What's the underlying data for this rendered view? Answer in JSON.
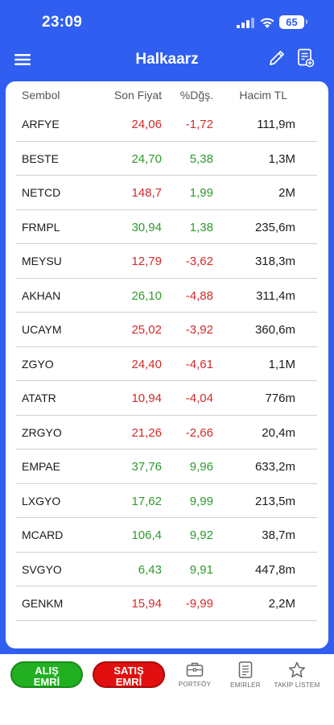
{
  "status": {
    "time": "23:09",
    "battery": "65"
  },
  "header": {
    "title": "Halkaarz"
  },
  "table": {
    "columns": [
      "Sembol",
      "Son Fiyat",
      "%Dğş.",
      "Hacim TL"
    ],
    "rows": [
      {
        "symbol": "ARFYE",
        "price": "24,06",
        "change": "-1,72",
        "volume": "111,9m",
        "price_dir": "down",
        "change_dir": "down"
      },
      {
        "symbol": "BESTE",
        "price": "24,70",
        "change": "5,38",
        "volume": "1,3M",
        "price_dir": "up",
        "change_dir": "up"
      },
      {
        "symbol": "NETCD",
        "price": "148,7",
        "change": "1,99",
        "volume": "2M",
        "price_dir": "down",
        "change_dir": "up"
      },
      {
        "symbol": "FRMPL",
        "price": "30,94",
        "change": "1,38",
        "volume": "235,6m",
        "price_dir": "up",
        "change_dir": "up"
      },
      {
        "symbol": "MEYSU",
        "price": "12,79",
        "change": "-3,62",
        "volume": "318,3m",
        "price_dir": "down",
        "change_dir": "down"
      },
      {
        "symbol": "AKHAN",
        "price": "26,10",
        "change": "-4,88",
        "volume": "311,4m",
        "price_dir": "up",
        "change_dir": "down"
      },
      {
        "symbol": "UCAYM",
        "price": "25,02",
        "change": "-3,92",
        "volume": "360,6m",
        "price_dir": "down",
        "change_dir": "down"
      },
      {
        "symbol": "ZGYO",
        "price": "24,40",
        "change": "-4,61",
        "volume": "1,1M",
        "price_dir": "down",
        "change_dir": "down"
      },
      {
        "symbol": "ATATR",
        "price": "10,94",
        "change": "-4,04",
        "volume": "776m",
        "price_dir": "down",
        "change_dir": "down"
      },
      {
        "symbol": "ZRGYO",
        "price": "21,26",
        "change": "-2,66",
        "volume": "20,4m",
        "price_dir": "down",
        "change_dir": "down"
      },
      {
        "symbol": "EMPAE",
        "price": "37,76",
        "change": "9,96",
        "volume": "633,2m",
        "price_dir": "up",
        "change_dir": "up"
      },
      {
        "symbol": "LXGYO",
        "price": "17,62",
        "change": "9,99",
        "volume": "213,5m",
        "price_dir": "up",
        "change_dir": "up"
      },
      {
        "symbol": "MCARD",
        "price": "106,4",
        "change": "9,92",
        "volume": "38,7m",
        "price_dir": "up",
        "change_dir": "up"
      },
      {
        "symbol": "SVGYO",
        "price": "6,43",
        "change": "9,91",
        "volume": "447,8m",
        "price_dir": "up",
        "change_dir": "up"
      },
      {
        "symbol": "GENKM",
        "price": "15,94",
        "change": "-9,99",
        "volume": "2,2M",
        "price_dir": "down",
        "change_dir": "down"
      }
    ]
  },
  "bottom": {
    "buy_line1": "ALIŞ",
    "buy_line2": "EMRİ",
    "sell_line1": "SATIŞ",
    "sell_line2": "EMRİ",
    "tabs": [
      {
        "label": "PORTFÖY",
        "icon": "briefcase-icon"
      },
      {
        "label": "EMİRLER",
        "icon": "document-icon"
      },
      {
        "label": "TAKİP LİSTEM",
        "icon": "star-icon"
      }
    ]
  },
  "colors": {
    "accent": "#2f5ef0",
    "up": "#2e9a2e",
    "down": "#d42a2a",
    "buy": "#22b022",
    "sell": "#e10f0f"
  }
}
